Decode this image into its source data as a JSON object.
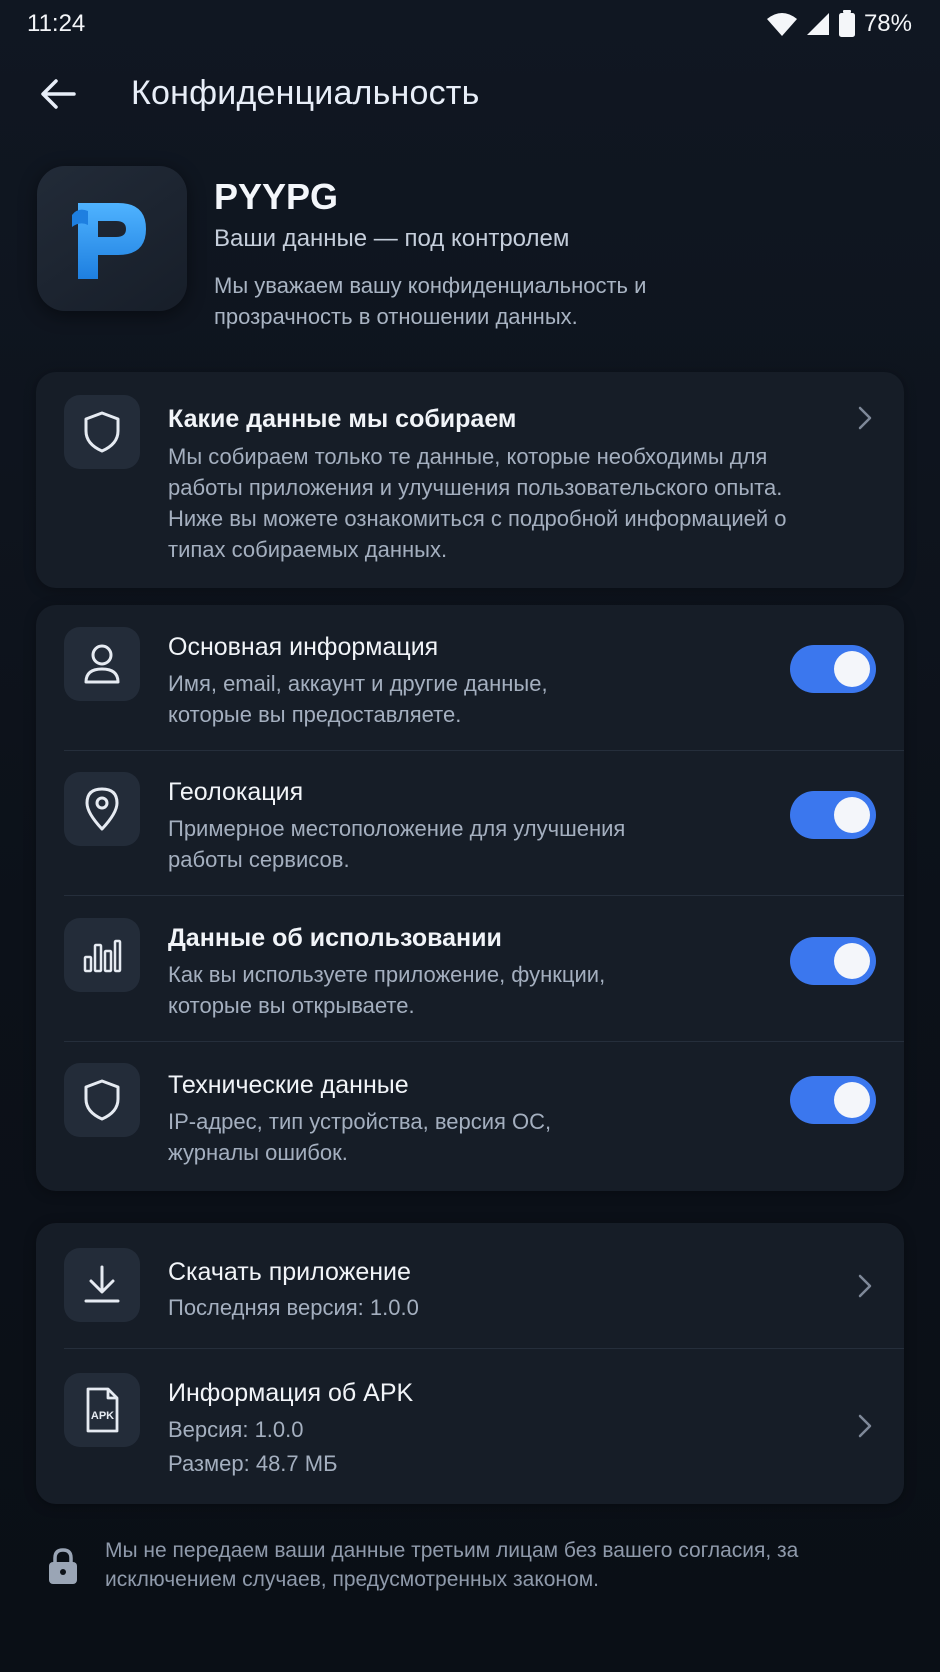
{
  "status_bar": {
    "time": "11:24",
    "battery": "78%",
    "icons": [
      "wifi-icon",
      "signal-icon",
      "battery-icon"
    ]
  },
  "top_bar": {
    "title": "Конфиденциальность",
    "back_icon": "arrow-left-icon"
  },
  "app": {
    "name": "PYYPG",
    "tagline": "Ваши данные — под контролем",
    "description": "Мы уважаем вашу конфиденциальность и прозрачность в отношении данных.",
    "logo_letter": "P"
  },
  "collect_card": {
    "icon": "shield-icon",
    "title": "Какие данные мы собираем",
    "text": "Мы собираем только те данные, которые необходимы для работы приложения и улучшения пользовательского опыта. Ниже вы можете ознакомиться с подробной информацией о типах собираемых данных."
  },
  "data_types": [
    {
      "icon": "user-icon",
      "title": "Основная информация",
      "text": "Имя, email, аккаунт и другие данные, которые вы предоставляете.",
      "enabled": true
    },
    {
      "icon": "location-pin-icon",
      "title": "Геолокация",
      "text": "Примерное местоположение для улучшения работы сервисов.",
      "enabled": true
    },
    {
      "icon": "bar-chart-icon",
      "title": "Данные об использовании",
      "text": "Как вы используете приложение, функции, которые вы открываете.",
      "enabled": true
    },
    {
      "icon": "shield-icon",
      "title": "Технические данные",
      "text": "IP-адрес, тип устройства, версия ОС, журналы ошибок.",
      "enabled": true
    }
  ],
  "download": {
    "icon": "download-icon",
    "title": "Скачать приложение",
    "version_text": "Последняя версия: 1.0.0"
  },
  "apk_info": {
    "icon": "apk-file-icon",
    "title": "Информация об APK",
    "version": "Версия: 1.0.0",
    "size": "Размер: 48.7 МБ",
    "icon_label": "APK"
  },
  "footer": {
    "icon": "lock-icon",
    "text": "Мы не передаем ваши данные третьим лицам без вашего согласия, за исключением случаев, предусмотренных законом."
  },
  "colors": {
    "background": "#0d1219",
    "card": "#161d27",
    "icon_box": "#232c39",
    "accent": "#3b77ee",
    "logo_blue": "#2f9bf0"
  }
}
